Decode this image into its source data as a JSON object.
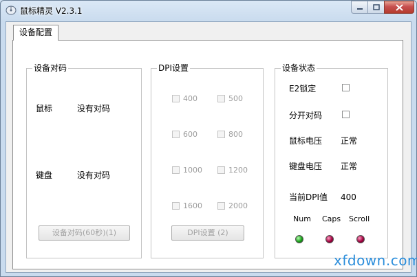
{
  "window": {
    "title": "鼠标精灵 V2.3.1"
  },
  "tabs": [
    {
      "label": "设备配置"
    }
  ],
  "pairing": {
    "title": "设备对码",
    "mouse_label": "鼠标",
    "mouse_status": "没有对码",
    "keyboard_label": "键盘",
    "keyboard_status": "没有对码",
    "button_label": "设备对码(60秒)(1)"
  },
  "dpi": {
    "title": "DPI设置",
    "options": [
      "400",
      "500",
      "600",
      "800",
      "1000",
      "1200",
      "1600",
      "2000"
    ],
    "button_label": "DPI设置 (2)"
  },
  "status": {
    "title": "设备状态",
    "e2_lock_label": "E2锁定",
    "split_pair_label": "分开对码",
    "mouse_voltage_label": "鼠标电压",
    "mouse_voltage_value": "正常",
    "keyboard_voltage_label": "键盘电压",
    "keyboard_voltage_value": "正常",
    "current_dpi_label": "当前DPI值",
    "current_dpi_value": "400",
    "indicators": [
      {
        "label": "Num",
        "color": "#1a9e1a"
      },
      {
        "label": "Caps",
        "color": "#a0003e"
      },
      {
        "label": "Scroll",
        "color": "#a0003e"
      }
    ]
  },
  "watermark": "xfdown.com"
}
